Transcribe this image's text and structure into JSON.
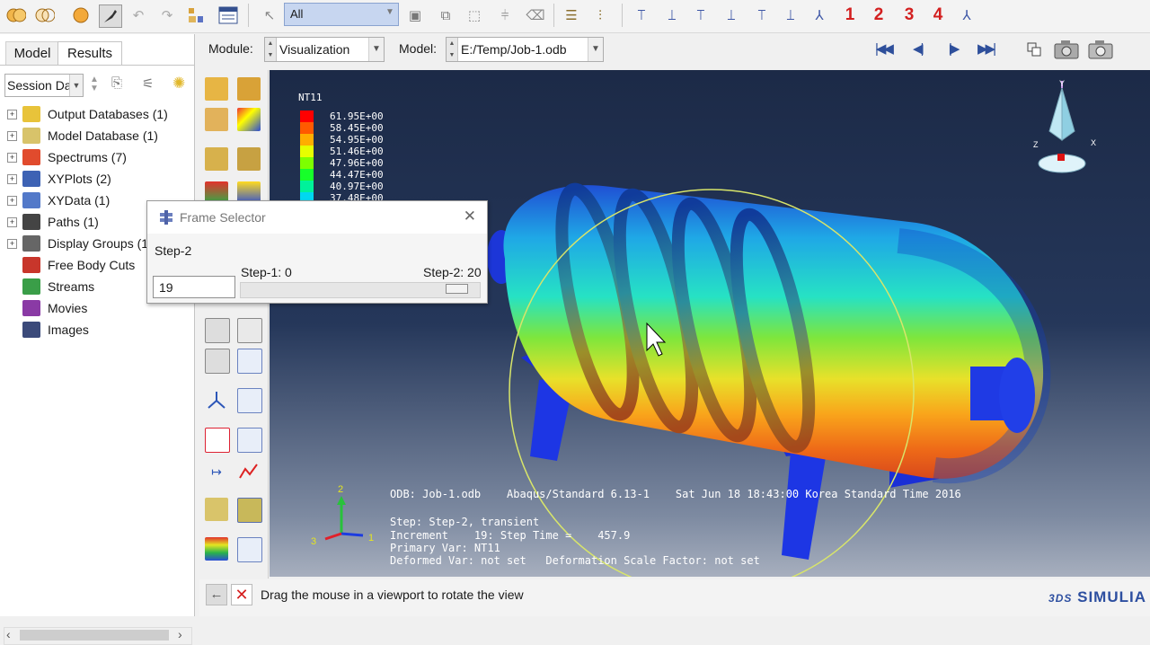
{
  "toolbar": {
    "select_filter": "All",
    "view_numbers": [
      "1",
      "2",
      "3",
      "4"
    ],
    "icons": [
      "render-shaded-icon",
      "undo-icon",
      "redo-icon",
      "select-arrow-icon",
      "box-zoom-icon",
      "view-x-icon",
      "view-y-icon",
      "view-z-icon",
      "iso-view-icon"
    ]
  },
  "module_bar": {
    "module_label": "Module:",
    "module_value": "Visualization",
    "model_label": "Model:",
    "model_value": "E:/Temp/Job-1.odb"
  },
  "left_panel": {
    "tabs": [
      "Model",
      "Results"
    ],
    "session_combo": "Session Da",
    "tree": [
      {
        "label": "Output Databases (1)",
        "expandable": true,
        "color": "#e8c33a"
      },
      {
        "label": "Model Database (1)",
        "expandable": true,
        "color": "#d8c36a"
      },
      {
        "label": "Spectrums (7)",
        "expandable": true,
        "color": "#e14b2d"
      },
      {
        "label": "XYPlots (2)",
        "expandable": true,
        "color": "#3d62b4"
      },
      {
        "label": "XYData (1)",
        "expandable": true,
        "color": "#5379c9"
      },
      {
        "label": "Paths (1)",
        "expandable": true,
        "color": "#444444"
      },
      {
        "label": "Display Groups (1",
        "expandable": true,
        "color": "#666666"
      },
      {
        "label": "Free Body Cuts",
        "expandable": false,
        "color": "#c8362b"
      },
      {
        "label": "Streams",
        "expandable": false,
        "color": "#3a9e48"
      },
      {
        "label": "Movies",
        "expandable": false,
        "color": "#8a3aa5"
      },
      {
        "label": "Images",
        "expandable": false,
        "color": "#3b4a7a"
      }
    ]
  },
  "legend": {
    "title": "NT11",
    "values": [
      "61.95E+00",
      "58.45E+00",
      "54.95E+00",
      "51.46E+00",
      "47.96E+00",
      "44.47E+00",
      "40.97E+00",
      "37.48E+00"
    ],
    "colors": [
      "#ff0000",
      "#ff5a00",
      "#ffae00",
      "#e6ff00",
      "#7dff00",
      "#17ff2a",
      "#00f29a",
      "#00d8f0"
    ]
  },
  "frame_selector": {
    "title": "Frame Selector",
    "step_label": "Step-2",
    "range_start": "Step-1: 0",
    "range_end": "Step-2: 20",
    "frame_value": "19",
    "slider_position": 0.95
  },
  "viewport_info": {
    "odb_line": "ODB: Job-1.odb    Abaqus/Standard 6.13-1    Sat Jun 18 18:43:00 Korea Standard Time 2016",
    "step_line": "Step: Step-2, transient",
    "increment_line": "Increment    19: Step Time =    457.9",
    "primary_var_line": "Primary Var: NT11",
    "deformed_line": "Deformed Var: not set   Deformation Scale Factor: not set",
    "triad_labels": [
      "1",
      "2",
      "3"
    ],
    "compass_labels": [
      "Y",
      "Z",
      "X"
    ]
  },
  "status_bar": {
    "prompt": "Drag the mouse in a viewport to rotate the view",
    "brand": "SIMULIA",
    "brand_prefix": "3DS"
  }
}
